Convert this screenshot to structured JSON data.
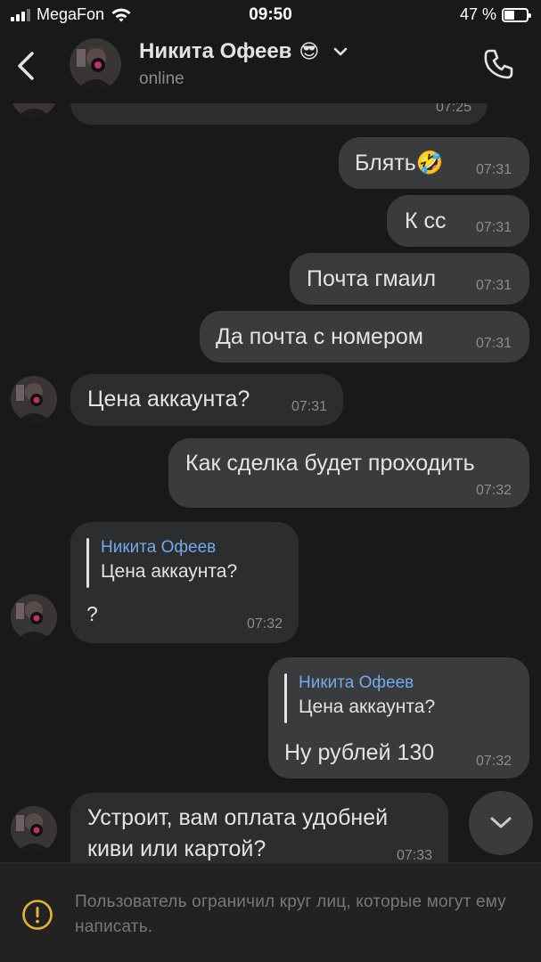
{
  "status_bar": {
    "carrier": "MegaFon",
    "time": "09:50",
    "battery": "47 %",
    "battery_level": 0.47
  },
  "header": {
    "contact_name": "Никита Офеев",
    "contact_emoji": "😎",
    "status": "online",
    "icons": [
      "back-arrow-icon",
      "chevron-down-icon",
      "phone-icon"
    ]
  },
  "messages": [
    {
      "direction": "in",
      "text": "",
      "time": "07:25"
    },
    {
      "direction": "out",
      "text": "Блять🤣",
      "time": "07:31"
    },
    {
      "direction": "out",
      "text": "К сс",
      "time": "07:31"
    },
    {
      "direction": "out",
      "text": "Почта гмаил",
      "time": "07:31"
    },
    {
      "direction": "out",
      "text": "Да почта с номером",
      "time": "07:31"
    },
    {
      "direction": "in",
      "text": "Цена аккаунта?",
      "time": "07:31"
    },
    {
      "direction": "out",
      "text": "Как сделка будет проходить",
      "time": "07:32"
    },
    {
      "direction": "in",
      "reply_name": "Никита Офеев",
      "reply_text": "Цена аккаунта?",
      "text": "?",
      "time": "07:32"
    },
    {
      "direction": "out",
      "reply_name": "Никита Офеев",
      "reply_text": "Цена аккаунта?",
      "text": "Ну рублей 130",
      "time": "07:32"
    },
    {
      "direction": "in",
      "text_line1": "Устроит, вам оплата удобней",
      "text_line2": "киви или картой?",
      "time": "07:33"
    }
  ],
  "footer": {
    "notice": "Пользователь ограничил круг лиц, которые могут ему написать.",
    "icon": "warning-circle-icon"
  },
  "colors": {
    "background": "#19191a",
    "bubble_in": "#2c2d2e",
    "bubble_out": "#3a3b3c",
    "reply_name": "#71aaeb",
    "warning": "#e3b232"
  }
}
